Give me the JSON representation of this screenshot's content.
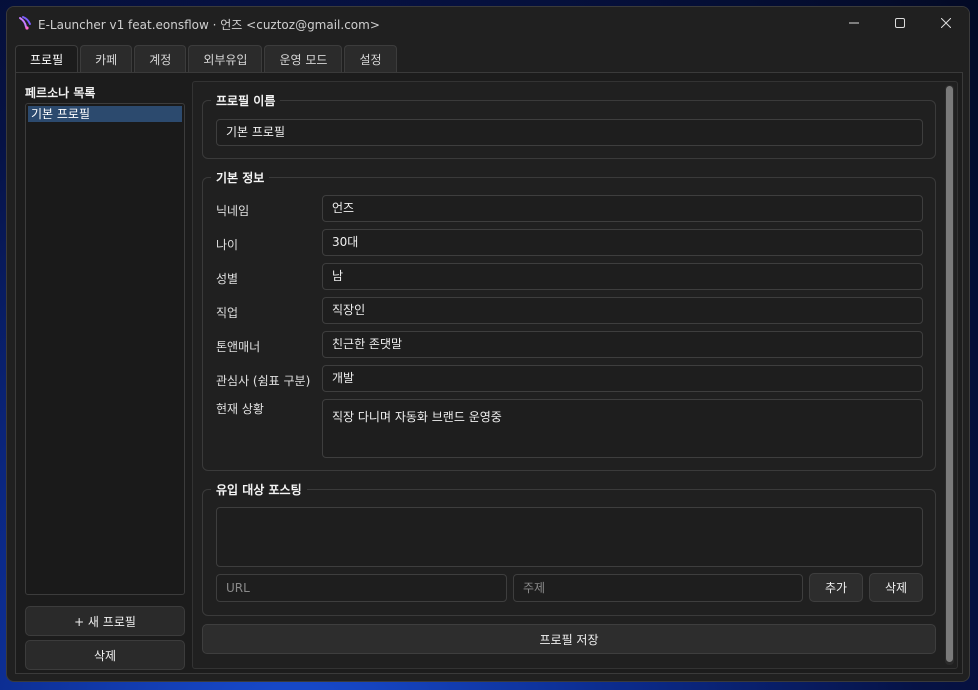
{
  "window": {
    "title": "E-Launcher v1 feat.eonsflow  ·  언즈 <cuztoz@gmail.com>",
    "controls": {
      "minimize": "—",
      "maximize": "☐",
      "close": "✕"
    }
  },
  "tabs": [
    {
      "label": "프로필",
      "active": true
    },
    {
      "label": "카페"
    },
    {
      "label": "계정"
    },
    {
      "label": "외부유입"
    },
    {
      "label": "운영 모드"
    },
    {
      "label": "설정"
    }
  ],
  "persona": {
    "title": "페르소나 목록",
    "items": [
      "기본 프로필"
    ],
    "new_button": "+ 새 프로필",
    "delete_button": "삭제"
  },
  "profile_name": {
    "group_title": "프로필 이름",
    "value": "기본 프로필"
  },
  "basic_info": {
    "group_title": "기본 정보",
    "fields": [
      {
        "label": "닉네임",
        "value": "언즈"
      },
      {
        "label": "나이",
        "value": "30대"
      },
      {
        "label": "성별",
        "value": "남"
      },
      {
        "label": "직업",
        "value": "직장인"
      },
      {
        "label": "톤앤매너",
        "value": "친근한 존댓말"
      },
      {
        "label": "관심사 (쉼표 구분)",
        "value": "개발"
      }
    ],
    "situation_label": "현재 상황",
    "situation_value": "직장 다니며 자동화 브랜드 운영중"
  },
  "posting": {
    "group_title": "유입 대상 포스팅",
    "url_placeholder": "URL",
    "topic_placeholder": "주제",
    "add_button": "추가",
    "delete_button": "삭제"
  },
  "save_button": "프로필 저장"
}
